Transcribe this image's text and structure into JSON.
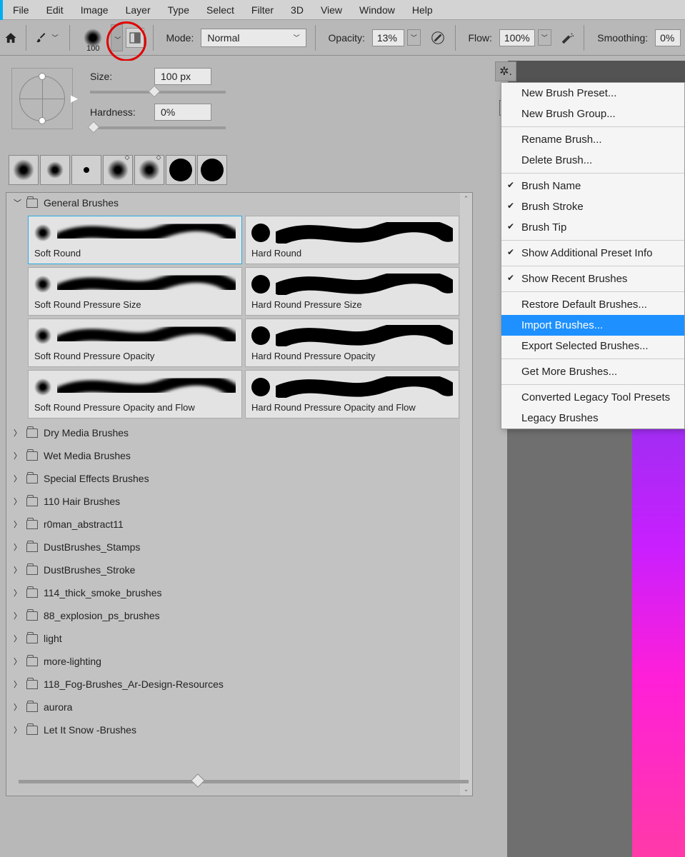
{
  "menu": {
    "items": [
      "File",
      "Edit",
      "Image",
      "Layer",
      "Type",
      "Select",
      "Filter",
      "3D",
      "View",
      "Window",
      "Help"
    ]
  },
  "toolbar": {
    "brush_preview_size": "100",
    "mode_label": "Mode:",
    "mode_value": "Normal",
    "opacity_label": "Opacity:",
    "opacity_value": "13%",
    "flow_label": "Flow:",
    "flow_value": "100%",
    "smoothing_label": "Smoothing:",
    "smoothing_value": "0%"
  },
  "brush_settings": {
    "size_label": "Size:",
    "size_value": "100 px",
    "hardness_label": "Hardness:",
    "hardness_value": "0%"
  },
  "groups": {
    "general": "General Brushes",
    "brushes": [
      {
        "name": "Soft Round",
        "tip": "soft",
        "selected": true
      },
      {
        "name": "Hard Round",
        "tip": "hard"
      },
      {
        "name": "Soft Round Pressure Size",
        "tip": "soft"
      },
      {
        "name": "Hard Round Pressure Size",
        "tip": "hard"
      },
      {
        "name": "Soft Round Pressure Opacity",
        "tip": "soft"
      },
      {
        "name": "Hard Round Pressure Opacity",
        "tip": "hard"
      },
      {
        "name": "Soft Round Pressure Opacity and Flow",
        "tip": "soft"
      },
      {
        "name": "Hard Round Pressure Opacity and Flow",
        "tip": "hard"
      }
    ],
    "folders": [
      "Dry Media Brushes",
      "Wet Media Brushes",
      "Special Effects Brushes",
      "110 Hair Brushes",
      "r0man_abstract11",
      "DustBrushes_Stamps",
      "DustBrushes_Stroke",
      "114_thick_smoke_brushes",
      "88_explosion_ps_brushes",
      "light",
      "more-lighting",
      "118_Fog-Brushes_Ar-Design-Resources",
      "aurora",
      "Let It Snow -Brushes"
    ]
  },
  "context_menu": {
    "items": [
      {
        "label": "New Brush Preset...",
        "type": "item"
      },
      {
        "label": "New Brush Group...",
        "type": "item"
      },
      {
        "type": "sep"
      },
      {
        "label": "Rename Brush...",
        "type": "item"
      },
      {
        "label": "Delete Brush...",
        "type": "item"
      },
      {
        "type": "sep"
      },
      {
        "label": "Brush Name",
        "type": "check"
      },
      {
        "label": "Brush Stroke",
        "type": "check"
      },
      {
        "label": "Brush Tip",
        "type": "check"
      },
      {
        "type": "sep"
      },
      {
        "label": "Show Additional Preset Info",
        "type": "check"
      },
      {
        "type": "sep"
      },
      {
        "label": "Show Recent Brushes",
        "type": "check"
      },
      {
        "type": "sep"
      },
      {
        "label": "Restore Default Brushes...",
        "type": "item"
      },
      {
        "label": "Import Brushes...",
        "type": "item",
        "hl": true
      },
      {
        "label": "Export Selected Brushes...",
        "type": "item"
      },
      {
        "type": "sep"
      },
      {
        "label": "Get More Brushes...",
        "type": "item"
      },
      {
        "type": "sep"
      },
      {
        "label": "Converted Legacy Tool Presets",
        "type": "item"
      },
      {
        "label": "Legacy Brushes",
        "type": "item"
      }
    ]
  }
}
